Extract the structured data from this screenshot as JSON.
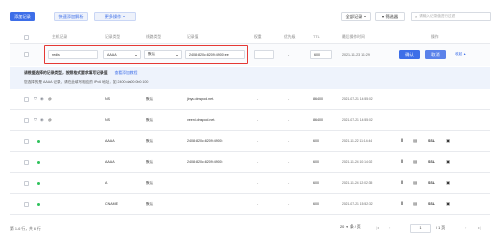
{
  "toolbar": {
    "add_record": "添加记录",
    "quick_add_resolve": "快速添加解析",
    "more_actions": "更多操作",
    "all_records": "全部记录",
    "filter": "筛选器",
    "search_placeholder": "请输入记录值进行过滤"
  },
  "columns": [
    "主机记录",
    "记录类型",
    "线路类型",
    "记录值",
    "权重",
    "优先级",
    "TTL",
    "最后操作时间",
    "操作"
  ],
  "edit_row": {
    "host": "redis",
    "type": "AAAA",
    "line": "默认",
    "value": "2408:820c:8209:4900:ee",
    "weight": "",
    "priority": "-",
    "ttl": "600",
    "time": "2021-11-23 11:29",
    "confirm": "确认",
    "cancel": "取消",
    "expand": "收起"
  },
  "notice": {
    "title": "请根据选择的记录类型，按照格式要求填写记录值",
    "link": "查看添加教程",
    "detail": "您选择的是 AAAA 记录，请在此填写相应的 IPv6 地址，如 2400:da00:0b0:100"
  },
  "rows": [
    {
      "status": "shield",
      "host": "@",
      "type": "NS",
      "line": "默认",
      "value": "jinyu.dnspod.net.",
      "weight": "-",
      "priority": "-",
      "ttl": "86400",
      "time": "2021-07-21 14:55:02",
      "actions": false
    },
    {
      "status": "shield",
      "host": "@",
      "type": "NS",
      "line": "默认",
      "value": "veeni.dnspod.net.",
      "weight": "-",
      "priority": "-",
      "ttl": "86400",
      "time": "2021-07-21 14:55:02",
      "actions": false
    },
    {
      "status": "green",
      "host": "",
      "type": "AAAA",
      "line": "默认",
      "value": "2408:820c:8209:4900:",
      "weight": "-",
      "priority": "-",
      "ttl": "600",
      "time": "2021-11-22 11:14:44",
      "actions": true
    },
    {
      "status": "green",
      "host": "",
      "type": "AAAA",
      "line": "默认",
      "value": "2408:820c:8209:4900:",
      "weight": "-",
      "priority": "-",
      "ttl": "600",
      "time": "2021-11-24 10:14:02",
      "actions": true
    },
    {
      "status": "green",
      "host": "",
      "type": "A",
      "line": "默认",
      "value": "",
      "weight": "-",
      "priority": "-",
      "ttl": "600",
      "time": "2021-11-24 12:02:35",
      "actions": true
    },
    {
      "status": "green",
      "host": "",
      "type": "CNAME",
      "line": "默认",
      "value": "",
      "weight": "-",
      "priority": "-",
      "ttl": "600",
      "time": "2021-07-21 15:52:32",
      "actions": true
    }
  ],
  "row_actions": {
    "ssl": "SSL"
  },
  "footer": {
    "summary": "第 1-6 行，共 6 行",
    "page_size": "20",
    "per_page": "条 / 页",
    "current_page": "1",
    "total_pages": "/ 1 页"
  },
  "colors": {
    "accent": "#3d6ee8",
    "highlight": "#e53935",
    "notice_bg": "#eef3fc",
    "green": "#2fc25b"
  }
}
